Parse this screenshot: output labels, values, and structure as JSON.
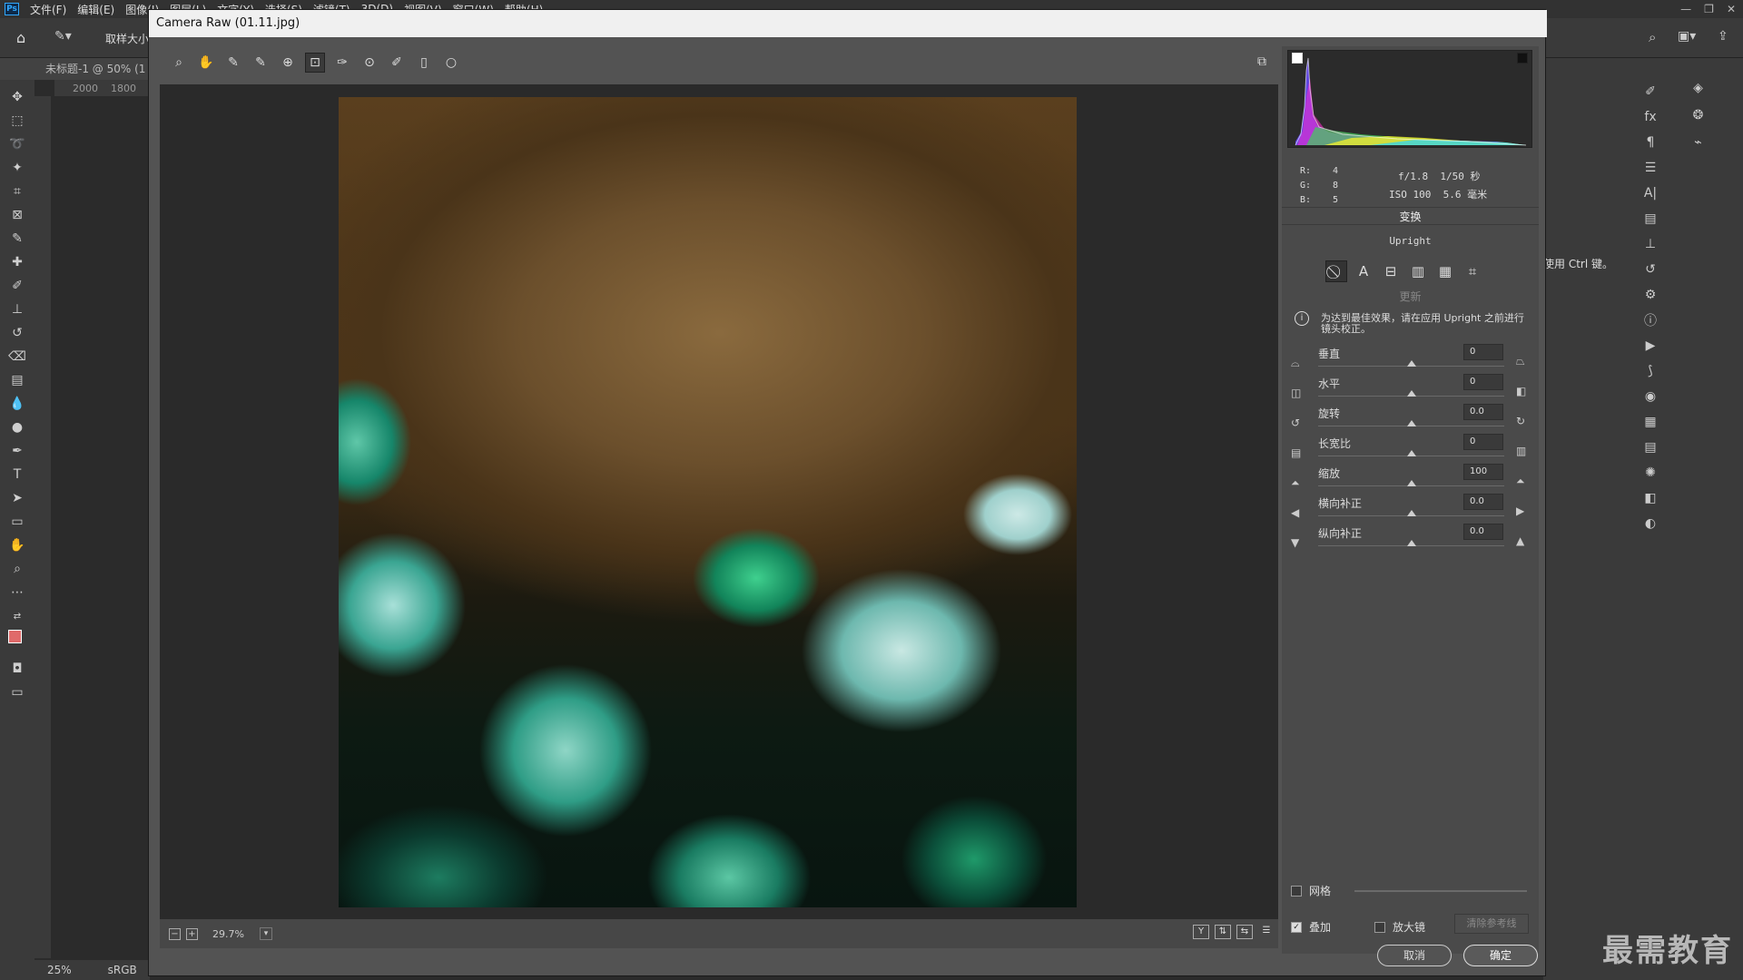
{
  "ps": {
    "logo": "Ps",
    "menus": [
      "文件(F)",
      "编辑(E)",
      "图像(I)",
      "图层(L)",
      "文字(Y)",
      "选择(S)",
      "滤镜(T)",
      "3D(D)",
      "视图(V)",
      "窗口(W)",
      "帮助(H)"
    ],
    "options_label": "取样大小",
    "doc_tab": "未标题-1 @ 50% (1",
    "ruler_ticks": [
      "2000",
      "1800"
    ],
    "status_zoom": "25%",
    "status_profile": "sRGB",
    "hint_text": "使用 Ctrl 键。",
    "watermark": "最需教育"
  },
  "dialog": {
    "title": "Camera Raw (01.11.jpg)",
    "zoom": "29.7%",
    "cancel": "取消",
    "ok": "确定"
  },
  "panel": {
    "rgb": [
      {
        "label": "R:",
        "value": "4"
      },
      {
        "label": "G:",
        "value": "8"
      },
      {
        "label": "B:",
        "value": "5"
      }
    ],
    "exif": {
      "aperture": "f/1.8",
      "shutter": "1/50 秒",
      "iso": "ISO 100",
      "focal": "5.6 毫米"
    },
    "section_title": "变换",
    "upright_title": "Upright",
    "update": "更新",
    "info": "为达到最佳效果，请在应用 Upright 之前进行镜头校正。",
    "sliders": [
      {
        "label": "垂直",
        "value": "0"
      },
      {
        "label": "水平",
        "value": "0"
      },
      {
        "label": "旋转",
        "value": "0.0"
      },
      {
        "label": "长宽比",
        "value": "0"
      },
      {
        "label": "缩放",
        "value": "100"
      },
      {
        "label": "横向补正",
        "value": "0.0"
      },
      {
        "label": "纵向补正",
        "value": "0.0"
      }
    ],
    "grid_label": "网格",
    "overlay_label": "叠加",
    "loupe_label": "放大镜",
    "clear_guides": "清除参考线"
  }
}
